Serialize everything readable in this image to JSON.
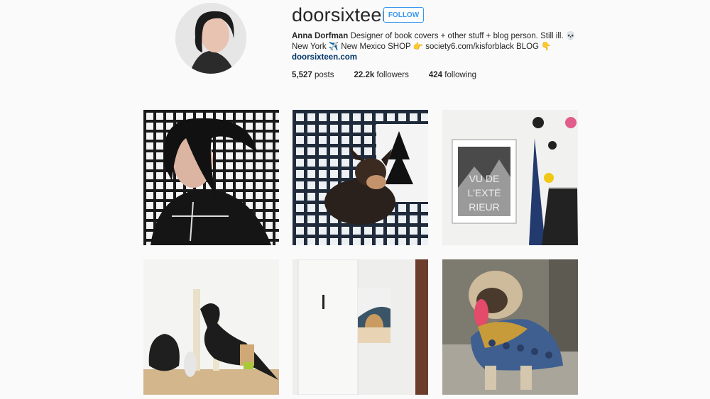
{
  "profile": {
    "username": "doorsixteen",
    "follow_label": "FOLLOW",
    "full_name": "Anna Dorfman",
    "bio_line1": "Designer of book covers + other stuff + blog person. Still ill. 💀",
    "bio_line2": "New York ✈️ New Mexico SHOP 👉 society6.com/kisforblack BLOG 👇",
    "website": "doorsixteen.com"
  },
  "stats": {
    "posts_count": "5,527",
    "posts_label": "posts",
    "followers_count": "22.2k",
    "followers_label": "followers",
    "following_count": "424",
    "following_label": "following"
  },
  "posts": {
    "poster_text": "VU DE L'EXTÉ RIEUR"
  }
}
